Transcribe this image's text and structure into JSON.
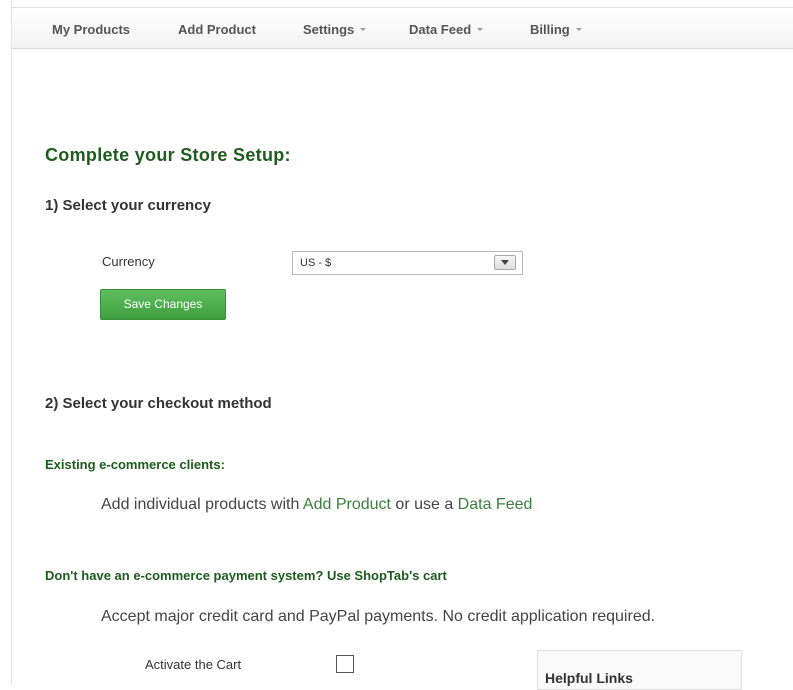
{
  "nav": {
    "items": [
      {
        "label": "My Products",
        "dropdown": false
      },
      {
        "label": "Add Product",
        "dropdown": false
      },
      {
        "label": "Settings",
        "dropdown": true
      },
      {
        "label": "Data Feed",
        "dropdown": true
      },
      {
        "label": "Billing",
        "dropdown": true
      }
    ]
  },
  "page": {
    "title": "Complete your Store Setup:"
  },
  "currency_section": {
    "heading": "1) Select your currency",
    "field_label": "Currency",
    "selected_value": "US - $",
    "save_label": "Save Changes"
  },
  "checkout_section": {
    "heading": "2) Select your checkout method",
    "existing": {
      "heading": "Existing e-commerce clients:",
      "text_before": "Add individual products with ",
      "link1": "Add Product",
      "text_middle": " or use a ",
      "link2": "Data Feed"
    },
    "no_system": {
      "heading": "Don't have an e-commerce payment system? Use ShopTab's cart",
      "text": "Accept major credit card and PayPal payments. No credit application required.",
      "activate_label": "Activate the Cart",
      "activate_checked": false
    }
  },
  "helpful_links": {
    "title": "Helpful Links"
  },
  "colors": {
    "accent_green": "#1e5b1e",
    "button_green": "#4cae4c",
    "link_green": "#3c7f3c"
  }
}
